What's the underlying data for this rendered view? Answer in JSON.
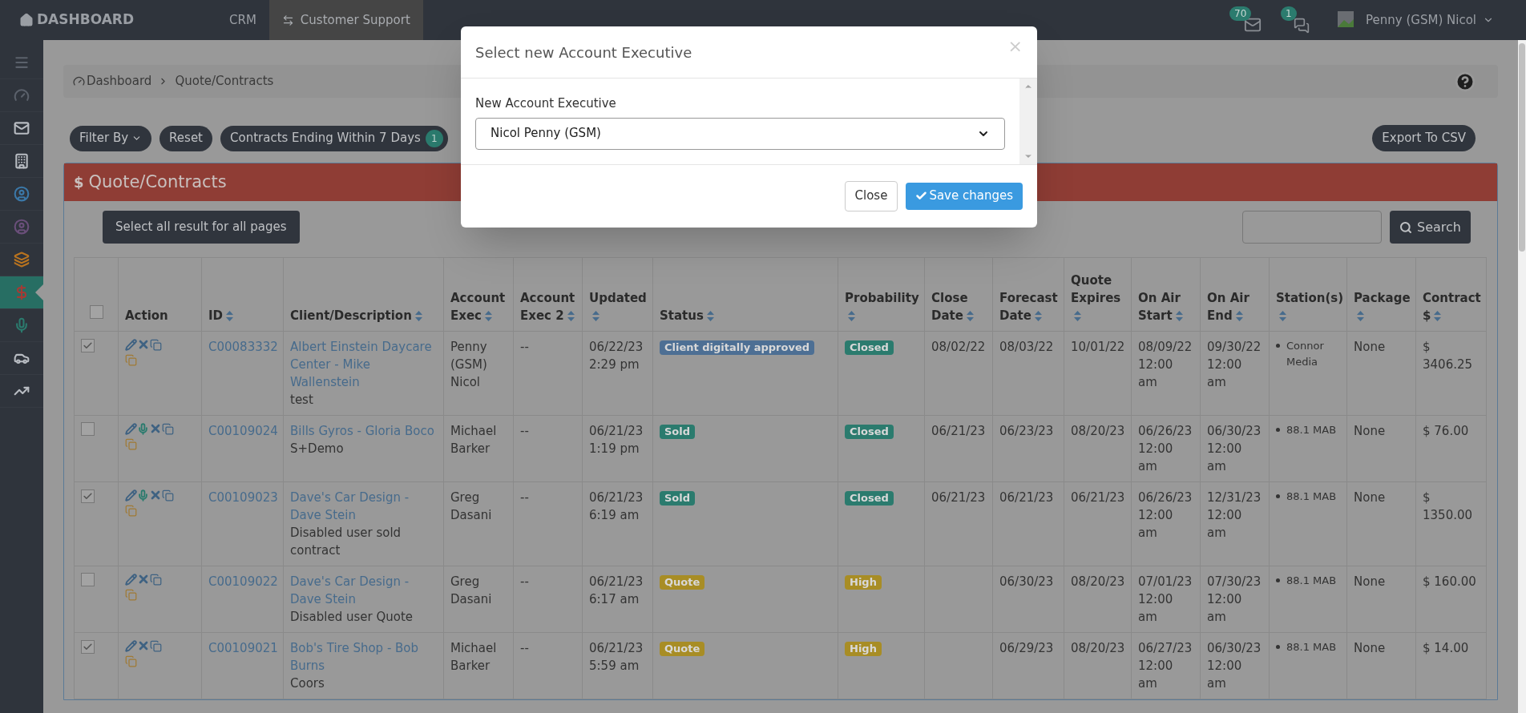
{
  "topbar": {
    "brand": "DASHBOARD",
    "nav": [
      {
        "label": "CRM",
        "selected": false,
        "kind": "plain"
      },
      {
        "label": "Customer Support",
        "selected": true,
        "kind": "switch"
      }
    ],
    "mail_count": "70",
    "chat_count": "1",
    "user": "Penny (GSM) Nicol"
  },
  "sidebar": {
    "items": [
      {
        "kind": "menu",
        "selected": false
      },
      {
        "kind": "gauge",
        "selected": false
      },
      {
        "kind": "mail",
        "selected": false
      },
      {
        "kind": "building",
        "selected": false
      },
      {
        "kind": "user-blue",
        "selected": false
      },
      {
        "kind": "user-purple",
        "selected": false
      },
      {
        "kind": "stack",
        "selected": false
      },
      {
        "kind": "dollar",
        "selected": true
      },
      {
        "kind": "mic",
        "selected": false
      },
      {
        "kind": "car",
        "selected": false
      },
      {
        "kind": "chart",
        "selected": false
      }
    ]
  },
  "breadcrumb": [
    "Dashboard",
    "Quote/Contracts"
  ],
  "filters": {
    "filter_by": "Filter By",
    "reset": "Reset",
    "ending": "Contracts Ending Within 7 Days",
    "ending_count": "1",
    "export": "Export To CSV"
  },
  "panel": {
    "title_icon": "$",
    "title": "Quote/Contracts",
    "select_all": "Select all result for all pages",
    "search_button": "Search"
  },
  "table": {
    "header_checked": false,
    "columns": [
      {
        "label": "Action",
        "sortable": false
      },
      {
        "label": "ID",
        "sortable": true
      },
      {
        "label": "Client/Description",
        "sortable": true
      },
      {
        "label": "Account Exec",
        "sortable": true
      },
      {
        "label": "Account Exec 2",
        "sortable": true
      },
      {
        "label": "Updated",
        "sortable": true
      },
      {
        "label": "Status",
        "sortable": true
      },
      {
        "label": "Probability",
        "sortable": true
      },
      {
        "label": "Close Date",
        "sortable": true
      },
      {
        "label": "Forecast Date",
        "sortable": true
      },
      {
        "label": "Quote Expires",
        "sortable": true
      },
      {
        "label": "On Air Start",
        "sortable": true
      },
      {
        "label": "On Air End",
        "sortable": true
      },
      {
        "label": "Station(s)",
        "sortable": true
      },
      {
        "label": "Package",
        "sortable": true
      },
      {
        "label": "Contract $",
        "sortable": true
      }
    ],
    "rows": [
      {
        "selected": true,
        "actions": [
          {
            "kind": "edit"
          },
          {
            "kind": "delete"
          },
          {
            "kind": "copy"
          }
        ],
        "id": "C00083332",
        "client": "Albert Einstein Daycare Center - Mike Wallenstein",
        "description": "test",
        "account_exec": "Penny (GSM) Nicol",
        "account_exec_2": "--",
        "updated": "06/22/23 2:29 pm",
        "status": {
          "label": "Client digitally approved",
          "color": "#4d6f94"
        },
        "probability": {
          "label": "Closed",
          "color": "#2b7b6e"
        },
        "close_date": "08/02/22",
        "forecast_date": "08/03/22",
        "quote_expires": "10/01/22",
        "on_air_start": "08/09/22 12:00 am",
        "on_air_end": "09/30/22 12:00 am",
        "stations": [
          "Connor Media"
        ],
        "package": "None",
        "contract": "$ 3406.25"
      },
      {
        "selected": false,
        "actions": [
          {
            "kind": "edit"
          },
          {
            "kind": "record"
          },
          {
            "kind": "delete"
          },
          {
            "kind": "copy"
          }
        ],
        "id": "C00109024",
        "client": "Bills Gyros - Gloria Boco",
        "description": "S+Demo",
        "account_exec": "Michael Barker",
        "account_exec_2": "--",
        "updated": "06/21/23 1:19 pm",
        "status": {
          "label": "Sold",
          "color": "#2b7b6e"
        },
        "probability": {
          "label": "Closed",
          "color": "#2b7b6e"
        },
        "close_date": "06/21/23",
        "forecast_date": "06/23/23",
        "quote_expires": "08/20/23",
        "on_air_start": "06/26/23 12:00 am",
        "on_air_end": "06/30/23 12:00 am",
        "stations": [
          "88.1 MAB"
        ],
        "package": "None",
        "contract": "$ 76.00"
      },
      {
        "selected": true,
        "actions": [
          {
            "kind": "edit"
          },
          {
            "kind": "record"
          },
          {
            "kind": "delete"
          },
          {
            "kind": "copy"
          }
        ],
        "id": "C00109023",
        "client": "Dave's Car Design - Dave Stein",
        "description": "Disabled user sold contract",
        "account_exec": "Greg Dasani",
        "account_exec_2": "--",
        "updated": "06/21/23 6:19 am",
        "status": {
          "label": "Sold",
          "color": "#2b7b6e"
        },
        "probability": {
          "label": "Closed",
          "color": "#2b7b6e"
        },
        "close_date": "06/21/23",
        "forecast_date": "06/21/23",
        "quote_expires": "06/21/23",
        "on_air_start": "06/26/23 12:00 am",
        "on_air_end": "12/31/23 12:00 am",
        "stations": [
          "88.1 MAB"
        ],
        "package": "None",
        "contract": "$ 1350.00"
      },
      {
        "selected": false,
        "actions": [
          {
            "kind": "edit"
          },
          {
            "kind": "delete"
          },
          {
            "kind": "copy"
          }
        ],
        "id": "C00109022",
        "client": "Dave's Car Design - Dave Stein",
        "description": "Disabled user Quote",
        "account_exec": "Greg Dasani",
        "account_exec_2": "--",
        "updated": "06/21/23 6:17 am",
        "status": {
          "label": "Quote",
          "color": "#a88d25"
        },
        "probability": {
          "label": "High",
          "color": "#a88d25"
        },
        "close_date": "",
        "forecast_date": "06/30/23",
        "quote_expires": "08/20/23",
        "on_air_start": "07/01/23 12:00 am",
        "on_air_end": "07/30/23 12:00 am",
        "stations": [
          "88.1 MAB"
        ],
        "package": "None",
        "contract": "$ 160.00"
      },
      {
        "selected": true,
        "actions": [
          {
            "kind": "edit"
          },
          {
            "kind": "delete"
          },
          {
            "kind": "copy"
          }
        ],
        "id": "C00109021",
        "client": "Bob's Tire Shop - Bob Burns",
        "description": "Coors",
        "account_exec": "Michael Barker",
        "account_exec_2": "--",
        "updated": "06/21/23 5:59 am",
        "status": {
          "label": "Quote",
          "color": "#a88d25"
        },
        "probability": {
          "label": "High",
          "color": "#a88d25"
        },
        "close_date": "",
        "forecast_date": "06/29/23",
        "quote_expires": "08/20/23",
        "on_air_start": "06/27/23 12:00 am",
        "on_air_end": "06/30/23 12:00 am",
        "stations": [
          "88.1 MAB"
        ],
        "package": "None",
        "contract": "$ 14.00"
      }
    ]
  },
  "modal": {
    "title": "Select new Account Executive",
    "close_icon": "×",
    "field_label": "New Account Executive",
    "value": "Nicol Penny (GSM)",
    "buttons": [
      {
        "label": "Close",
        "kind": "default"
      },
      {
        "label": "Save changes",
        "kind": "primary"
      }
    ]
  }
}
